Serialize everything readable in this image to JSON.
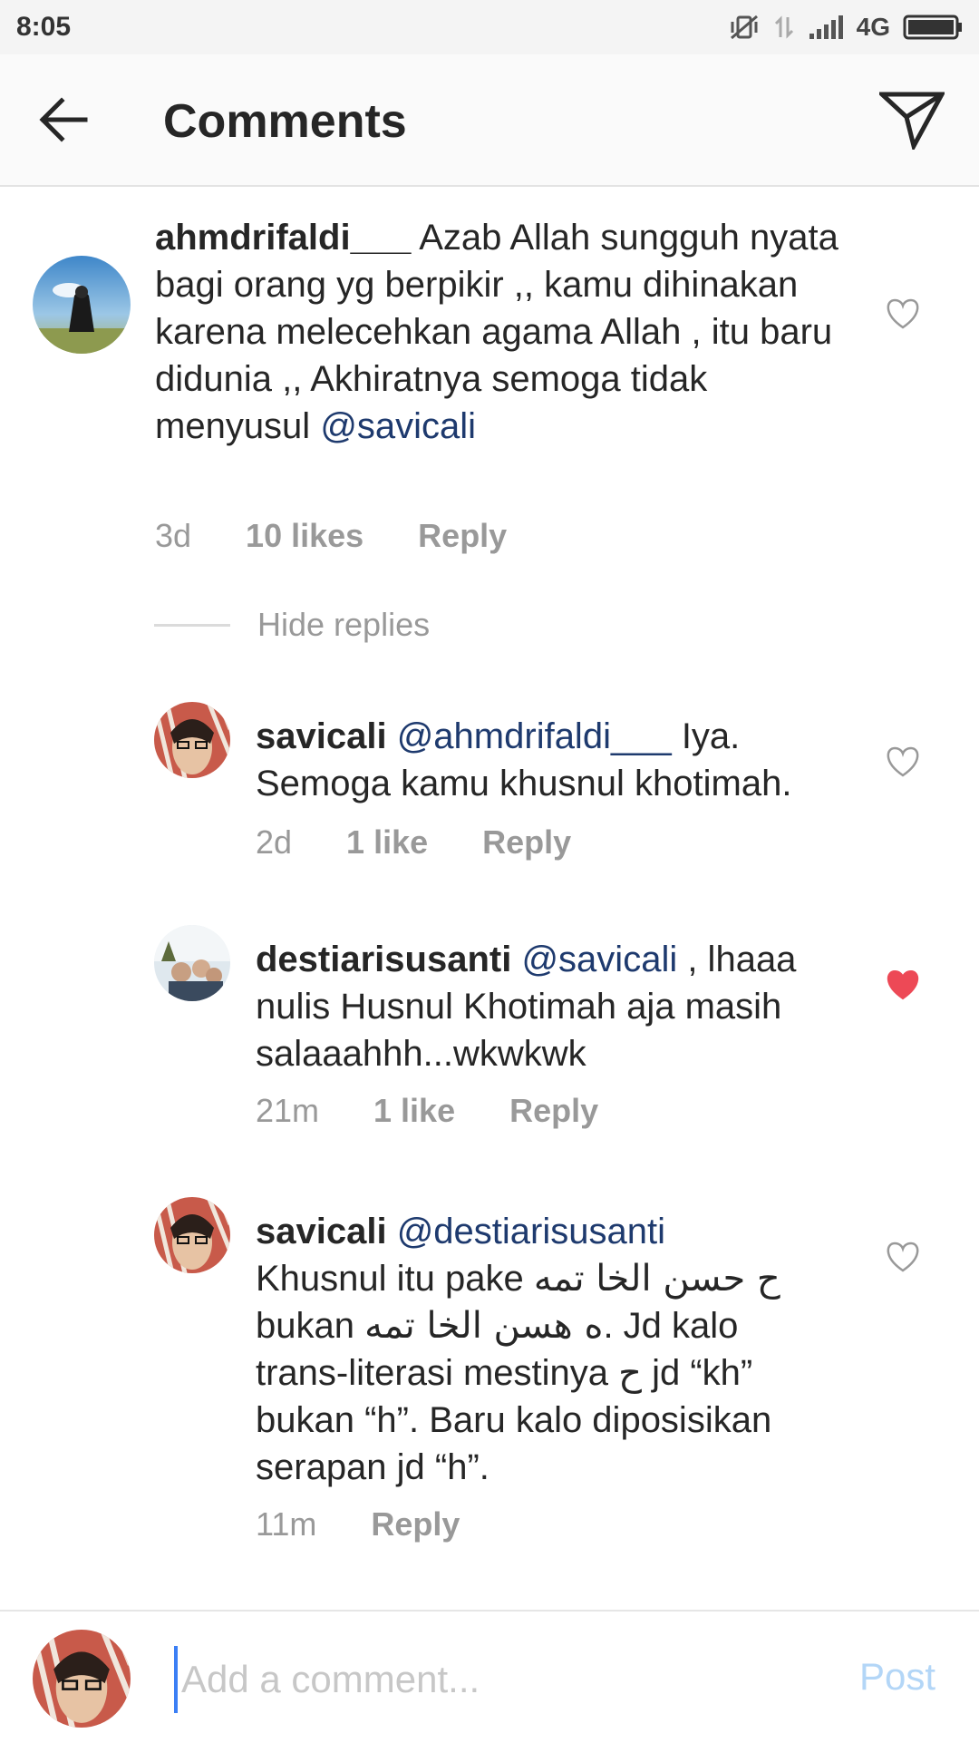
{
  "status_bar": {
    "time": "8:05",
    "network": "4G"
  },
  "header": {
    "title": "Comments"
  },
  "comments": [
    {
      "username": "ahmdrifaldi___",
      "text": " Azab Allah sungguh nyata bagi orang yg berpikir ,, kamu dihinakan karena melecehkan agama Allah , itu baru didunia ,, Akhiratnya semoga tidak menyusul ",
      "mention": "@savicali",
      "time": "3d",
      "likes": "10 likes",
      "reply": "Reply",
      "liked": false
    },
    {
      "username": "savicali",
      "mention": "@ahmdrifaldi___",
      "text": " Iya. Semoga kamu khusnul khotimah.",
      "time": "2d",
      "likes": "1 like",
      "reply": "Reply",
      "liked": false
    },
    {
      "username": "destiarisusanti",
      "mention": "@savicali",
      "text": " , lhaaa nulis Husnul Khotimah aja masih salaaahhh...wkwkwk",
      "time": "21m",
      "likes": "1 like",
      "reply": "Reply",
      "liked": true
    },
    {
      "username": "savicali",
      "mention": "@destiarisusanti",
      "line1": "Khusnul itu pake ",
      "arabic1": "ح حسن الخا تمه",
      "line2_pre": "bukan ",
      "arabic2": "ه هسن الخا تمه",
      "line2_post": ". Jd kalo",
      "line3_pre": "trans-literasi mestinya ",
      "arabic3": "ح",
      "line3_post": " jd “kh”",
      "line4": "bukan “h”. Baru kalo diposisikan",
      "line5": "serapan jd “h”.",
      "time": "11m",
      "reply": "Reply",
      "liked": false
    }
  ],
  "hide_replies": "Hide replies",
  "composer": {
    "placeholder": "Add a comment...",
    "post_label": "Post"
  },
  "colors": {
    "heart_liked": "#ed4956",
    "mention": "#1e3a6e",
    "post_disabled": "#b3d6f7"
  }
}
